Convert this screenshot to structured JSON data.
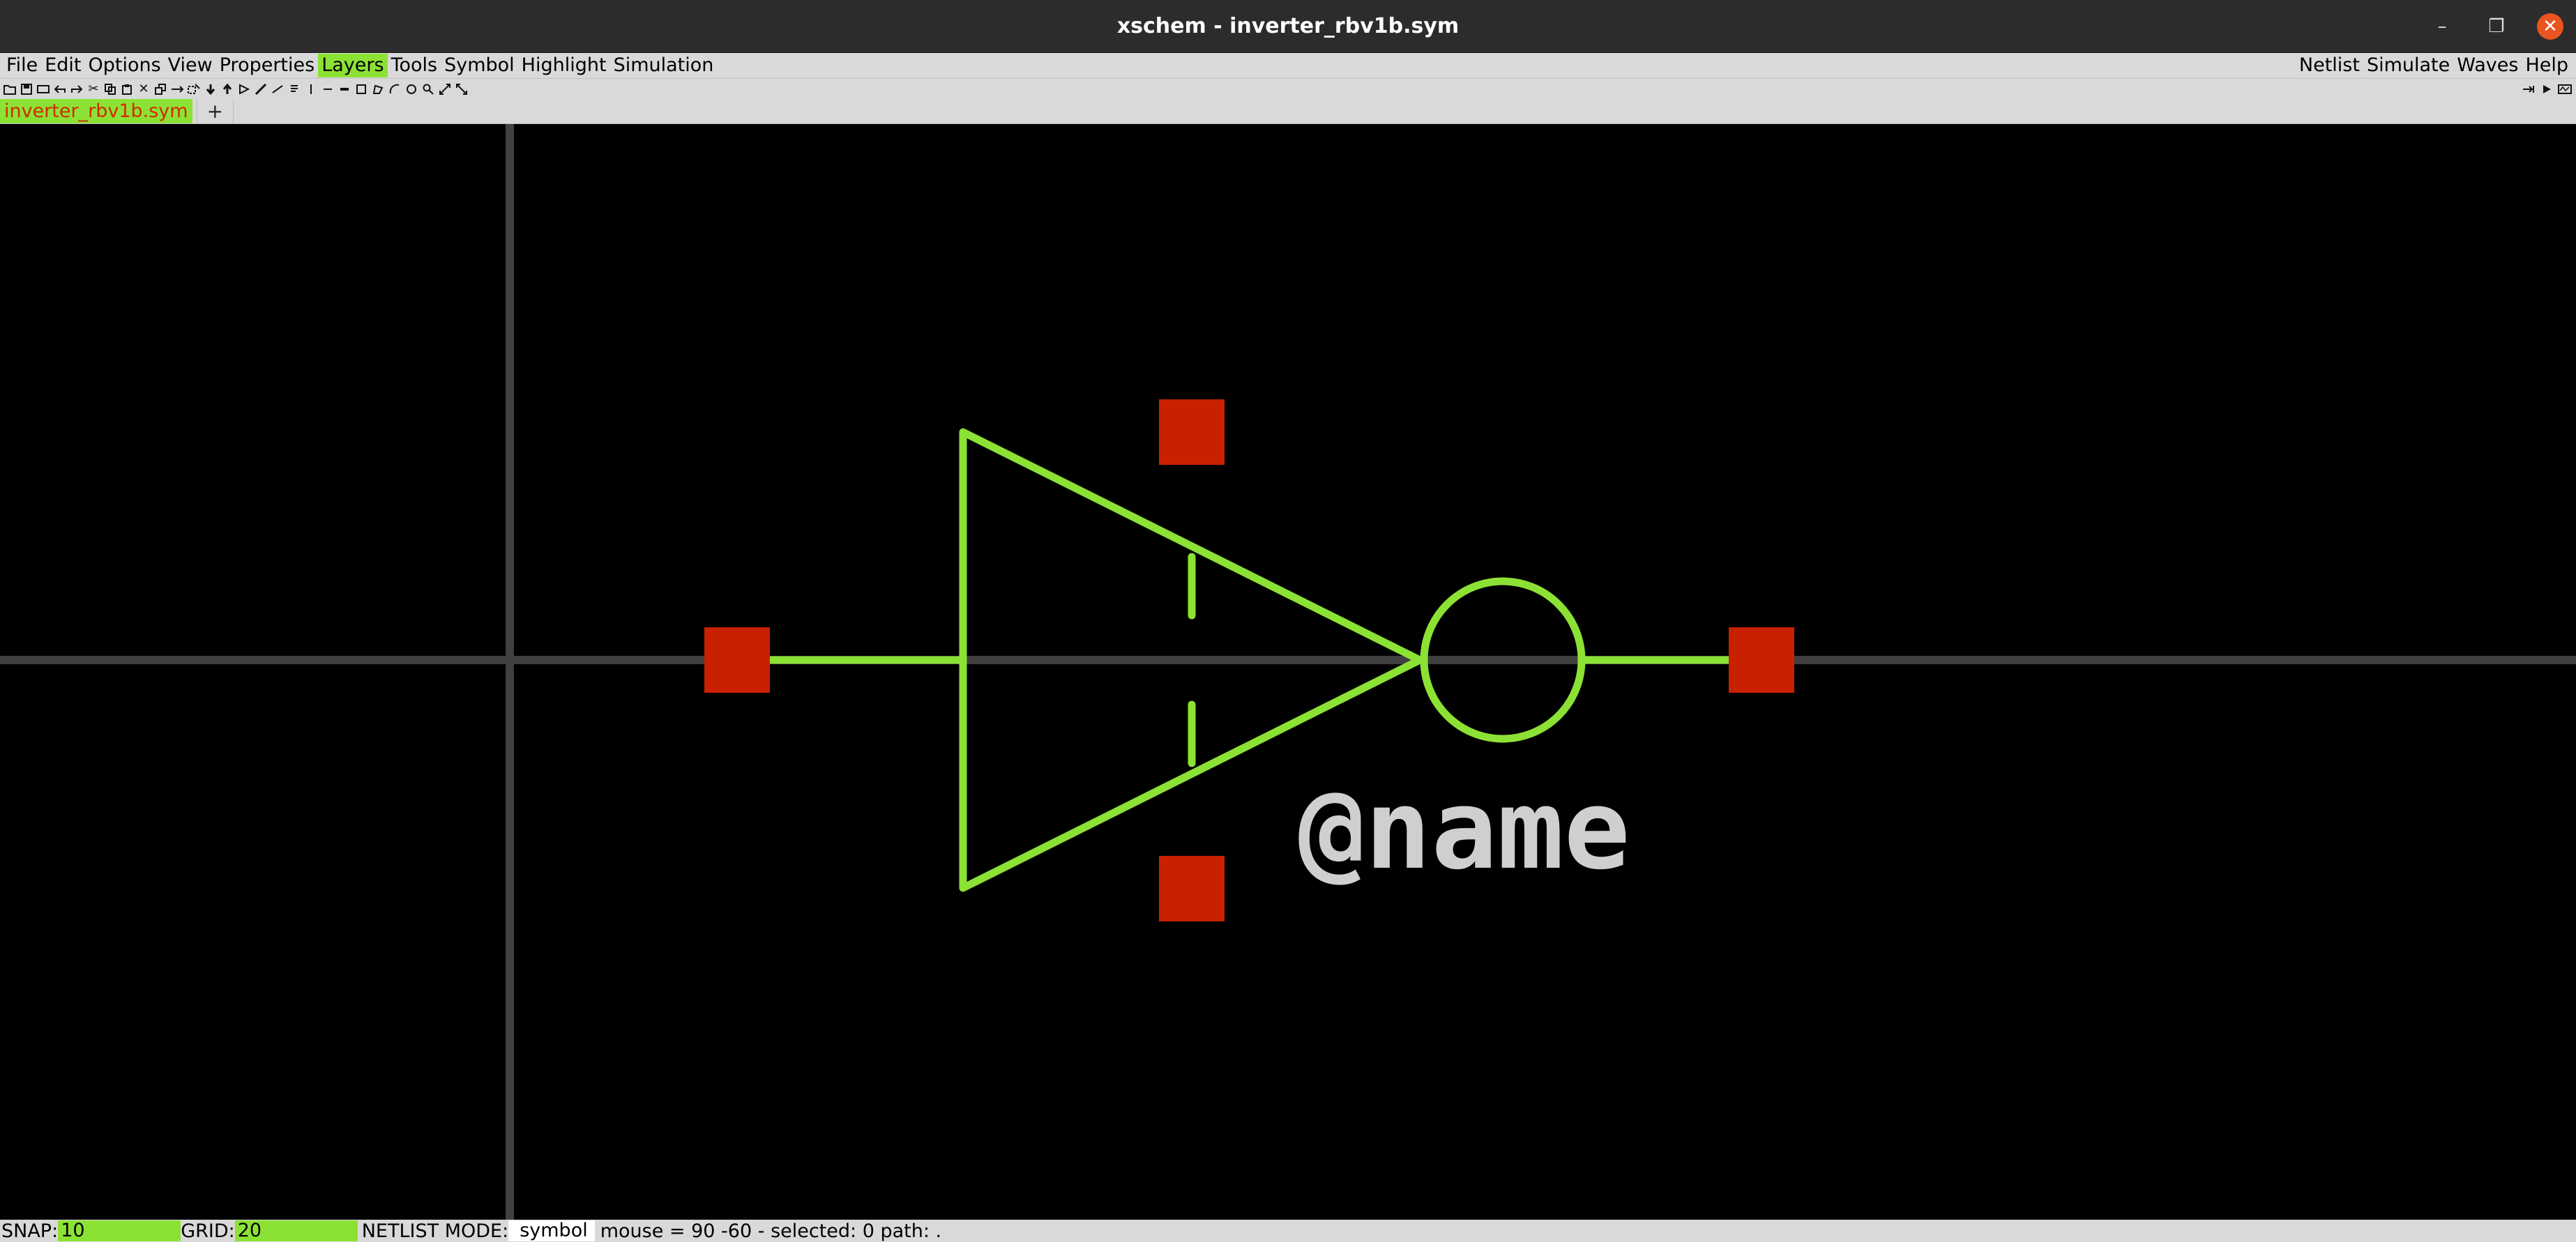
{
  "window": {
    "title": "xschem - inverter_rbv1b.sym",
    "controls": {
      "minimize": "–",
      "maximize": "❐",
      "close": "✕"
    }
  },
  "menubar": {
    "left": [
      "File",
      "Edit",
      "Options",
      "View",
      "Properties",
      "Layers",
      "Tools",
      "Symbol",
      "Highlight",
      "Simulation"
    ],
    "right": [
      "Netlist",
      "Simulate",
      "Waves",
      "Help"
    ],
    "active": "Layers"
  },
  "toolbar": {
    "left_icons": [
      "open-icon",
      "save-icon",
      "reload-icon",
      "undo-icon",
      "redo-icon",
      "cut-icon",
      "copy-icon",
      "paste-icon",
      "delete-icon",
      "duplicate-icon",
      "move-icon",
      "select-icon",
      "push-icon",
      "pop-icon",
      "place-symbol-icon",
      "place-wire-icon",
      "line-icon",
      "text-icon",
      "label-icon",
      "net-label-icon",
      "bus-icon",
      "rectangle-icon",
      "polygon-icon",
      "arc-icon",
      "circle-icon",
      "zoom-icon",
      "zoom-full-icon",
      "zoom-selection-icon"
    ],
    "right_icons": [
      "netlist-icon",
      "simulate-icon",
      "waves-icon"
    ]
  },
  "tabs": {
    "items": [
      {
        "label": "inverter_rbv1b.sym",
        "active": true
      }
    ],
    "add_label": "+"
  },
  "canvas": {
    "background": "#000000",
    "axis_color": "#404040",
    "symbol_color": "#8ce234",
    "pin_color": "#c82000",
    "text_color": "#cfcfcf",
    "symbol_text": "@name",
    "symbol": "inverter"
  },
  "statusbar": {
    "snap_label": "SNAP:",
    "snap_value": "10",
    "grid_label": "GRID:",
    "grid_value": "20",
    "netlist_mode_label": "NETLIST MODE:",
    "netlist_mode_value": "symbol",
    "mouse_info": "mouse = 90 -60 - selected: 0 path: ."
  },
  "colors": {
    "accent_green": "#8ce234",
    "chrome_gray": "#d9d9d9",
    "titlebar": "#2c2c2c",
    "close_button": "#e95420"
  }
}
